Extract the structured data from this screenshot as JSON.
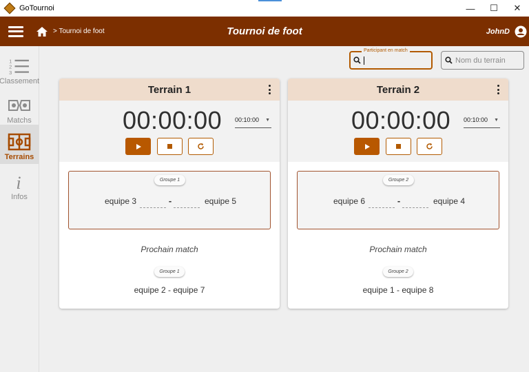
{
  "window": {
    "title": "GoTournoi",
    "controls": {
      "minimize": "—",
      "maximize": "☐",
      "close": "✕"
    }
  },
  "appbar": {
    "breadcrumb": "> Tournoi de foot",
    "title": "Tournoi de foot",
    "user": "JohnD"
  },
  "sidebar": {
    "items": [
      {
        "label": "Classement",
        "icon": "ranking-list-icon",
        "active": false
      },
      {
        "label": "Matchs",
        "icon": "matches-icon",
        "active": false
      },
      {
        "label": "Terrains",
        "icon": "field-icon",
        "active": true
      },
      {
        "label": "Infos",
        "icon": "info-icon",
        "active": false
      }
    ]
  },
  "search": {
    "participant_label": "Participant en match",
    "participant_value": "",
    "terrain_placeholder": "Nom du terrain"
  },
  "courts": [
    {
      "name": "Terrain 1",
      "timer": "00:00:00",
      "duration": "00:10:00",
      "current": {
        "group": "Groupe 1",
        "team_a": "equipe 3",
        "team_b": "equipe 5",
        "separator": "-"
      },
      "next_label": "Prochain match",
      "next": {
        "group": "Groupe 1",
        "teams": "equipe 2 - equipe 7"
      }
    },
    {
      "name": "Terrain 2",
      "timer": "00:00:00",
      "duration": "00:10:00",
      "current": {
        "group": "Groupe 2",
        "team_a": "equipe 6",
        "team_b": "equipe 4",
        "separator": "-"
      },
      "next_label": "Prochain match",
      "next": {
        "group": "Groupe 2",
        "teams": "equipe 1 - equipe 8"
      }
    }
  ],
  "colors": {
    "brand": "#7c2f00",
    "accent": "#b85800",
    "card_header": "#efdccc"
  }
}
